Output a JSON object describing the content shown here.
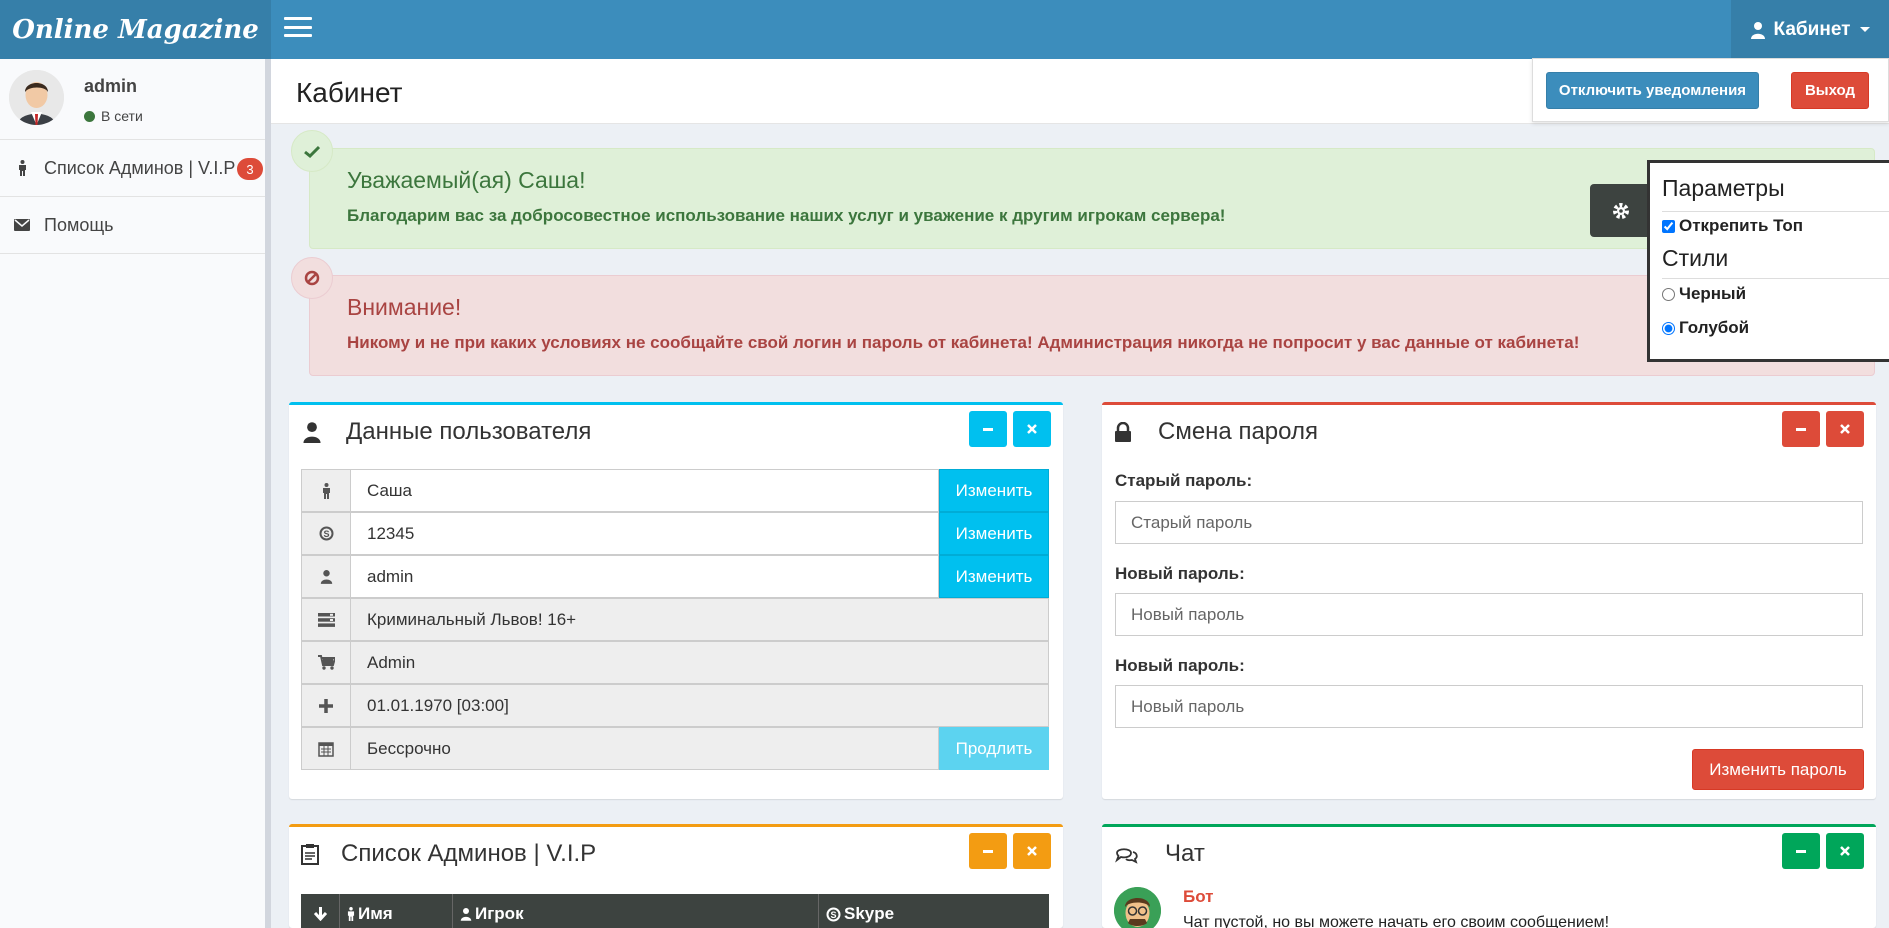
{
  "header": {
    "logo": "Online Magazine",
    "cabinet_label": "Кабинет",
    "dropdown": {
      "notifications_button": "Отключить уведомления",
      "logout_button": "Выход"
    }
  },
  "sidebar": {
    "user": {
      "name": "admin",
      "status": "В сети"
    },
    "items": [
      {
        "label": "Список Админов | V.I.P",
        "icon": "male-icon",
        "badge": "3"
      },
      {
        "label": "Помощь",
        "icon": "envelope-icon"
      }
    ]
  },
  "page": {
    "title": "Кабинет"
  },
  "alerts": {
    "success": {
      "title": "Уважаемый(ая) Саша!",
      "text": "Благодарим вас за добросовестное использование наших услуг и уважение к другим игрокам сервера!"
    },
    "danger": {
      "title": "Внимание!",
      "text": "Никому и не при каких условиях не сообщайте свой логин и пароль от кабинета! Администрация никогда не попросит у вас данные от кабинета!"
    }
  },
  "settings": {
    "title": "Параметры",
    "unpin_top": {
      "label": "Открепить Топ",
      "checked": true
    },
    "styles_title": "Стили",
    "styles": [
      {
        "label": "Черный",
        "selected": false
      },
      {
        "label": "Голубой",
        "selected": true
      }
    ]
  },
  "user_data": {
    "title": "Данные пользователя",
    "change_label": "Изменить",
    "extend_label": "Продлить",
    "rows": [
      {
        "icon": "male-icon",
        "value": "Саша"
      },
      {
        "icon": "skype-icon",
        "value": "12345"
      },
      {
        "icon": "user-icon",
        "value": "admin"
      },
      {
        "icon": "server-icon",
        "value": "Криминальный Львов! 16+"
      },
      {
        "icon": "cart-icon",
        "value": "Admin"
      },
      {
        "icon": "plus-icon",
        "value": "01.01.1970 [03:00]"
      },
      {
        "icon": "calendar-icon",
        "value": "Бессрочно"
      }
    ]
  },
  "password": {
    "title": "Смена пароля",
    "old_label": "Старый пароль:",
    "old_placeholder": "Старый пароль",
    "new_label": "Новый пароль:",
    "new_placeholder": "Новый пароль",
    "repeat_label": "Новый пароль:",
    "repeat_placeholder": "Новый пароль",
    "submit": "Изменить пароль"
  },
  "admins": {
    "title": "Список Админов | V.I.P",
    "columns": [
      "Имя",
      "Игрок",
      "Skype"
    ]
  },
  "chat": {
    "title": "Чат",
    "sender": "Бот",
    "message": "Чат пустой, но вы можете начать его своим сообщением!"
  },
  "colors": {
    "header": "#3c8dbc",
    "info": "#00c0ef",
    "danger": "#dd4b39",
    "warning": "#f39c12",
    "success": "#00a65a"
  }
}
